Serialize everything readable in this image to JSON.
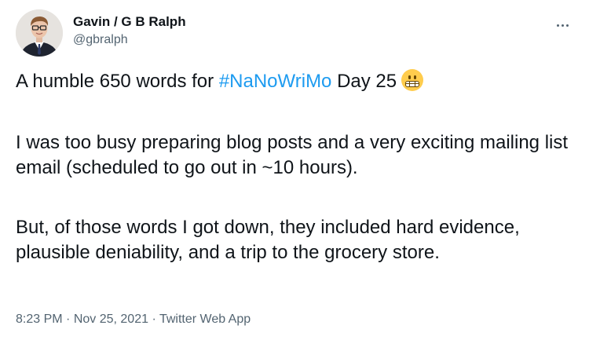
{
  "author": {
    "display_name": "Gavin / G B Ralph",
    "handle": "@gbralph"
  },
  "tweet": {
    "line1": {
      "prefix": "A humble 650 words for ",
      "hashtag": "#NaNoWriMo",
      "suffix": " Day 25",
      "emoji": "grimacing-face"
    },
    "paragraph2": "I was too busy preparing blog posts and a very exciting mailing list email (scheduled to go out in ~10 hours).",
    "paragraph3": "But, of those words I got down, they included hard evidence, plausible deniability, and a trip to the grocery store."
  },
  "meta": {
    "time": "8:23 PM",
    "separator": " · ",
    "date": "Nov 25, 2021",
    "source": "Twitter Web App"
  },
  "colors": {
    "text": "#0f1419",
    "secondary": "#536471",
    "link": "#1d9bf0",
    "background": "#ffffff"
  },
  "icons": {
    "more": "more-horizontal-icon"
  }
}
